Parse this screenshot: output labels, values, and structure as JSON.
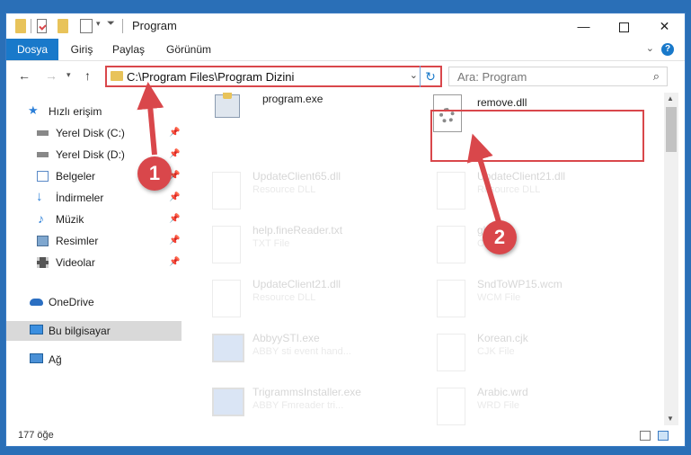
{
  "window": {
    "title": "Program",
    "controls": [
      "minimize-icon",
      "maximize-icon",
      "close-icon"
    ]
  },
  "ribbon": {
    "tabs": [
      {
        "label": "Dosya",
        "active": true
      },
      {
        "label": "Giriş",
        "active": false
      },
      {
        "label": "Paylaş",
        "active": false
      },
      {
        "label": "Görünüm",
        "active": false
      }
    ]
  },
  "nav": {
    "address": "C:\\Program Files\\Program Dizini",
    "search_placeholder": "Ara: Program"
  },
  "sidebar": {
    "items": [
      {
        "label": "Hızlı erişim",
        "icon": "star-icon",
        "pinned": false
      },
      {
        "label": "Yerel Disk (C:)",
        "icon": "drive-icon",
        "pinned": true
      },
      {
        "label": "Yerel Disk (D:)",
        "icon": "drive-icon",
        "pinned": true
      },
      {
        "label": "Belgeler",
        "icon": "documents-icon",
        "pinned": true
      },
      {
        "label": "İndirmeler",
        "icon": "download-icon",
        "pinned": true
      },
      {
        "label": "Müzik",
        "icon": "music-icon",
        "pinned": true
      },
      {
        "label": "Resimler",
        "icon": "pictures-icon",
        "pinned": true
      },
      {
        "label": "Videolar",
        "icon": "video-icon",
        "pinned": true
      },
      {
        "label": "OneDrive",
        "icon": "cloud-icon",
        "pinned": false
      },
      {
        "label": "Bu bilgisayar",
        "icon": "computer-icon",
        "pinned": false,
        "selected": true
      },
      {
        "label": "Ağ",
        "icon": "network-icon",
        "pinned": false
      }
    ]
  },
  "files": [
    {
      "name": "program.exe",
      "type": "",
      "icon": "installer-icon",
      "faded": false
    },
    {
      "name": "remove.dll",
      "type": "",
      "icon": "dll-icon",
      "faded": false
    },
    {
      "name": "UpdateClient65.dll",
      "type": "Resource DLL",
      "icon": "dll-icon",
      "faded": true
    },
    {
      "name": "UpdateClient21.dll",
      "type": "Resource DLL",
      "icon": "dll-icon",
      "faded": true
    },
    {
      "name": "help.fineReader.txt",
      "type": "TXT File",
      "icon": "text-file-icon",
      "faded": true
    },
    {
      "name": "glob",
      "type": "C",
      "icon": "file-icon",
      "faded": true
    },
    {
      "name": "UpdateClient21.dll",
      "type": "Resource DLL",
      "icon": "dll-icon",
      "faded": true
    },
    {
      "name": "SndToWP15.wcm",
      "type": "WCM File",
      "icon": "file-icon",
      "faded": true
    },
    {
      "name": "AbbyySTI.exe",
      "type": "ABBY sti event hand...",
      "icon": "app-icon",
      "faded": true
    },
    {
      "name": "Korean.cjk",
      "type": "CJK File",
      "icon": "file-icon",
      "faded": true
    },
    {
      "name": "TrigrammsInstaller.exe",
      "type": "ABBY Fmreader tri...",
      "icon": "app-icon",
      "faded": true
    },
    {
      "name": "Arabic.wrd",
      "type": "WRD File",
      "icon": "file-icon",
      "faded": true
    }
  ],
  "status": {
    "item_count": "177 öğe"
  },
  "annotations": {
    "step1": "1",
    "step2": "2",
    "color": "#d9474b"
  }
}
